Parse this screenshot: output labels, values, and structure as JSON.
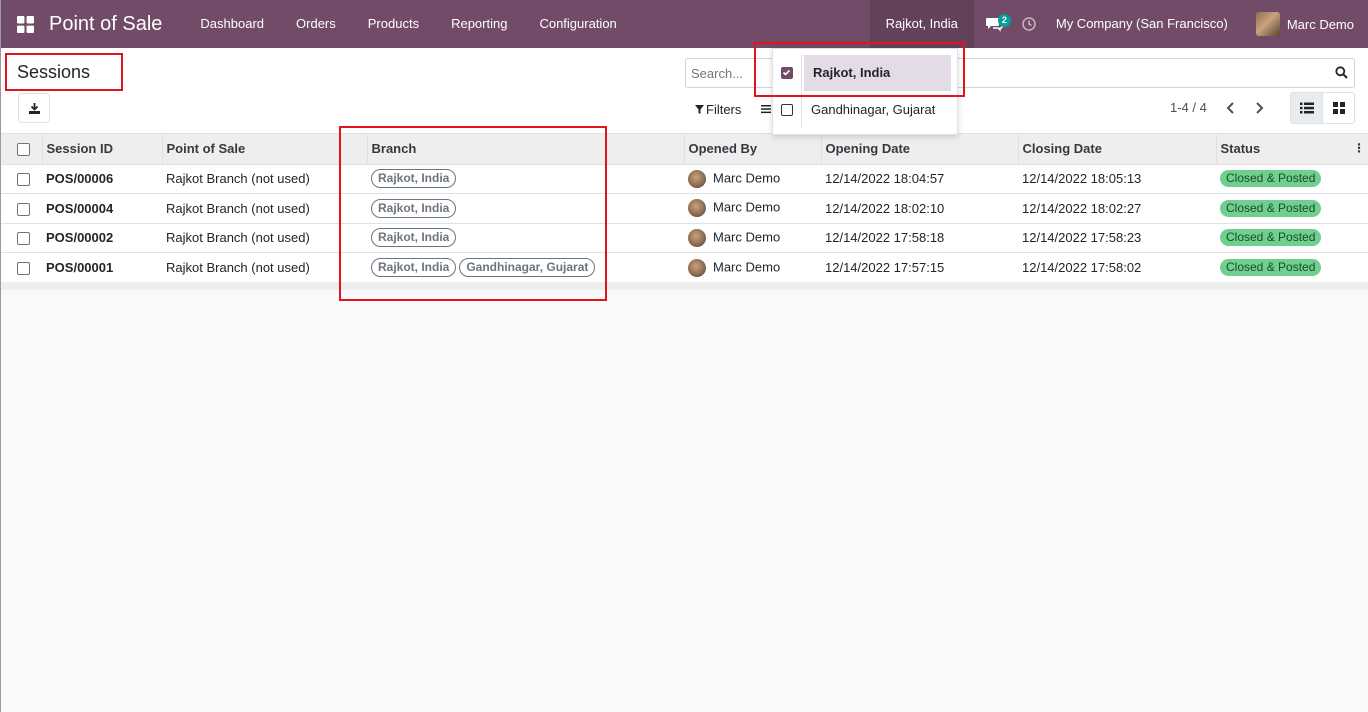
{
  "navbar": {
    "app_title": "Point of Sale",
    "menu": [
      "Dashboard",
      "Orders",
      "Products",
      "Reporting",
      "Configuration"
    ],
    "branch_switch": "Rajkot, India",
    "chat_count": "2",
    "company": "My Company (San Francisco)",
    "user": "Marc Demo"
  },
  "control_panel": {
    "title": "Sessions",
    "search_placeholder": "Search...",
    "filters_label": "Filters",
    "pager": "1-4 / 4"
  },
  "branch_dropdown": {
    "items": [
      {
        "label": "Rajkot, India",
        "checked": true
      },
      {
        "label": "Gandhinagar, Gujarat",
        "checked": false
      }
    ]
  },
  "table": {
    "columns": [
      "Session ID",
      "Point of Sale",
      "Branch",
      "Opened By",
      "Opening Date",
      "Closing Date",
      "Status"
    ],
    "rows": [
      {
        "id": "POS/00006",
        "pos": "Rajkot Branch (not used)",
        "branches": [
          "Rajkot, India"
        ],
        "opened_by": "Marc Demo",
        "opening": "12/14/2022 18:04:57",
        "closing": "12/14/2022 18:05:13",
        "status": "Closed & Posted"
      },
      {
        "id": "POS/00004",
        "pos": "Rajkot Branch (not used)",
        "branches": [
          "Rajkot, India"
        ],
        "opened_by": "Marc Demo",
        "opening": "12/14/2022 18:02:10",
        "closing": "12/14/2022 18:02:27",
        "status": "Closed & Posted"
      },
      {
        "id": "POS/00002",
        "pos": "Rajkot Branch (not used)",
        "branches": [
          "Rajkot, India"
        ],
        "opened_by": "Marc Demo",
        "opening": "12/14/2022 17:58:18",
        "closing": "12/14/2022 17:58:23",
        "status": "Closed & Posted"
      },
      {
        "id": "POS/00001",
        "pos": "Rajkot Branch (not used)",
        "branches": [
          "Rajkot, India",
          "Gandhinagar, Gujarat"
        ],
        "opened_by": "Marc Demo",
        "opening": "12/14/2022 17:57:15",
        "closing": "12/14/2022 17:58:02",
        "status": "Closed & Posted"
      }
    ]
  },
  "colors": {
    "brand": "#714b67",
    "status_badge": "#6fcf8e",
    "annotation": "#e0141a"
  }
}
